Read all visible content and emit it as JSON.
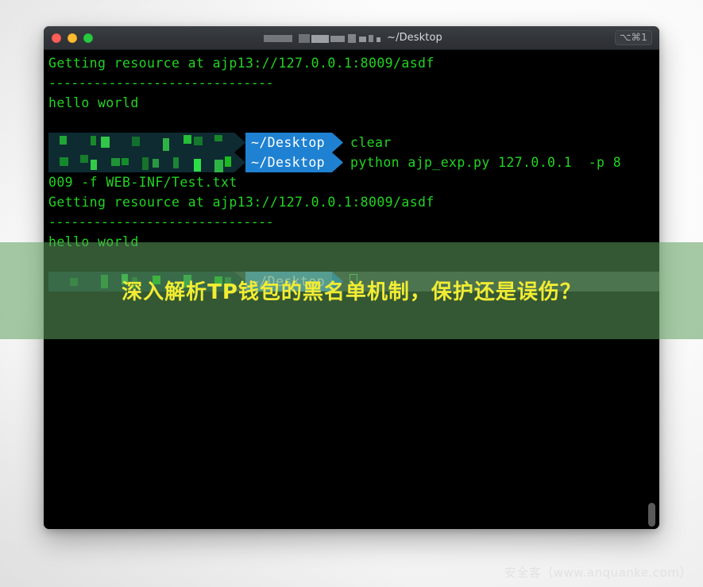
{
  "window": {
    "title_suffix": "~/Desktop",
    "shortcut": "⌥⌘1",
    "traffic_lights": {
      "close_label": "close",
      "minimize_label": "minimize",
      "zoom_label": "zoom"
    },
    "colors": {
      "titlebar": "#323539",
      "body": "#000000",
      "prompt_blue": "#1f81d1",
      "prompt_mosaic_bg": "#0e2b31",
      "text_green": "#22d422",
      "overlay_green": "rgba(92,160,92,.55)",
      "overlay_text_yellow": "#f2ec33"
    }
  },
  "terminal": {
    "lines": [
      {
        "type": "output",
        "text": "Getting resource at ajp13://127.0.0.1:8009/asdf"
      },
      {
        "type": "output",
        "text": "------------------------------"
      },
      {
        "type": "output",
        "text": "hello world"
      },
      {
        "type": "blank",
        "text": ""
      }
    ],
    "prompts": [
      {
        "path": "~/Desktop",
        "command": "clear"
      },
      {
        "path": "~/Desktop",
        "command": "python ajp_exp.py 127.0.0.1  -p 8"
      }
    ],
    "lines_after": [
      {
        "type": "output",
        "text": "009 -f WEB-INF/Test.txt"
      },
      {
        "type": "output",
        "text": "Getting resource at ajp13://127.0.0.1:8009/asdf"
      },
      {
        "type": "output",
        "text": "------------------------------"
      },
      {
        "type": "output",
        "text": "hello world"
      },
      {
        "type": "blank",
        "text": ""
      }
    ],
    "active_prompt": {
      "path": "~/Desktop",
      "command": ""
    }
  },
  "overlay": {
    "text": "深入解析TP钱包的黑名单机制，保护还是误伤？"
  },
  "watermark": {
    "text": "安全客（www.anquanke.com）"
  }
}
